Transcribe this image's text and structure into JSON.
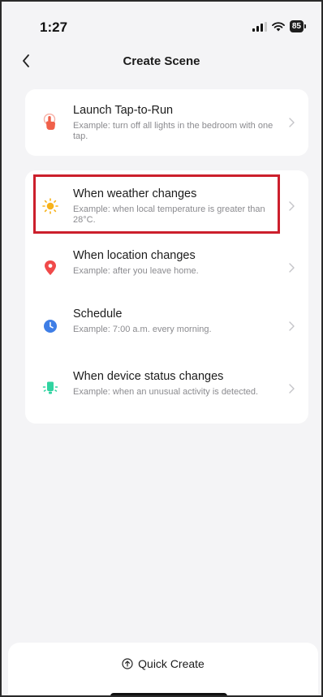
{
  "status_bar": {
    "time": "1:27",
    "battery": "85"
  },
  "nav": {
    "title": "Create Scene",
    "back_icon": "chevron-left-icon"
  },
  "launch_card": {
    "title": "Launch Tap-to-Run",
    "description": "Example: turn off all lights in the bedroom with one tap.",
    "icon": "tap-hand-icon",
    "icon_color": "#f0604a"
  },
  "conditions": [
    {
      "title": "When weather changes",
      "description": "Example: when local temperature is greater than 28°C.",
      "icon": "sun-icon",
      "icon_color": "#f7b21a"
    },
    {
      "title": "When location changes",
      "description": "Example: after you leave home.",
      "icon": "location-pin-icon",
      "icon_color": "#f04a4a"
    },
    {
      "title": "Schedule",
      "description": "Example: 7:00 a.m. every morning.",
      "icon": "clock-icon",
      "icon_color": "#3e7ee6"
    },
    {
      "title": "When device status changes",
      "description": "Example: when an unusual activity is detected.",
      "icon": "device-bulb-icon",
      "icon_color": "#2fd3a0"
    }
  ],
  "bottom": {
    "quick_create": "Quick Create",
    "quick_icon": "arrow-up-circle-icon"
  },
  "highlight_color": "#cc1f2c"
}
